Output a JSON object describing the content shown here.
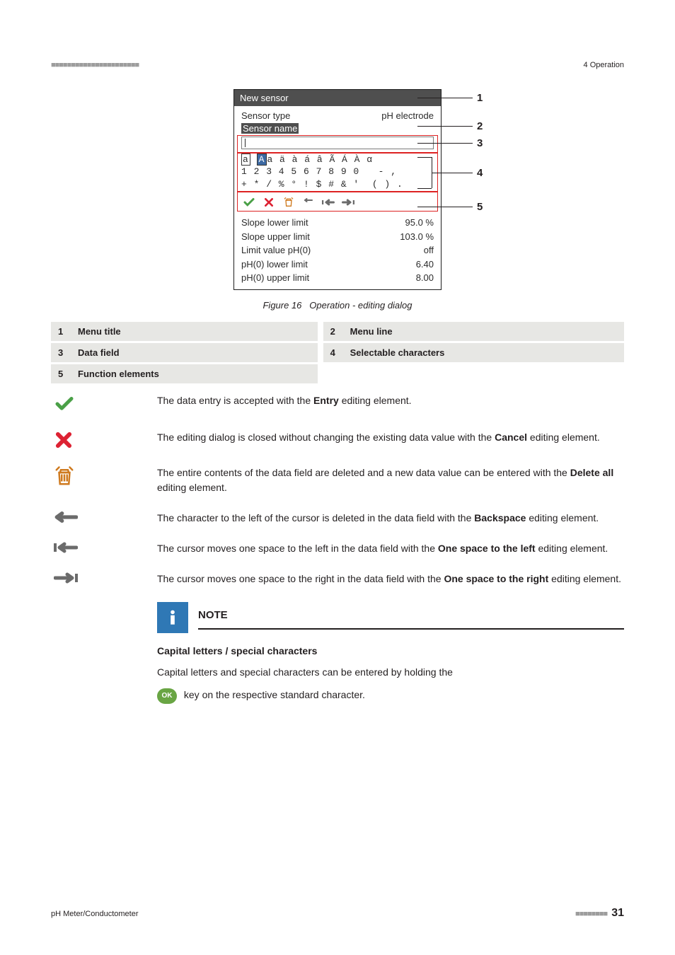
{
  "runhead": {
    "left_marks": "■■■■■■■■■■■■■■■■■■■■■■",
    "right": "4 Operation"
  },
  "device": {
    "title": "New sensor",
    "rows_top": [
      {
        "l": "Sensor type",
        "r": "pH electrode"
      }
    ],
    "hl_line": "Sensor name",
    "char_rows": {
      "r1a": "a",
      "r1_hl": "A",
      "r1_rest": "a ä à á â Ã Á À α",
      "r2": "1 2 3 4 5 6 7 8 9 0   - ,",
      "r3": "+ * / % ° ! $ # & '  ( ) ."
    },
    "rows_bottom": [
      {
        "l": "Slope lower limit",
        "r": "95.0 %"
      },
      {
        "l": "Slope upper limit",
        "r": "103.0 %"
      },
      {
        "l": "Limit value pH(0)",
        "r": "off"
      },
      {
        "l": "pH(0) lower limit",
        "r": "6.40"
      },
      {
        "l": "pH(0) upper limit",
        "r": "8.00"
      }
    ]
  },
  "callouts": [
    "1",
    "2",
    "3",
    "4",
    "5"
  ],
  "figure": {
    "num": "Figure 16",
    "title": "Operation - editing dialog"
  },
  "legend": [
    {
      "n": "1",
      "t": "Menu title"
    },
    {
      "n": "2",
      "t": "Menu line"
    },
    {
      "n": "3",
      "t": "Data field"
    },
    {
      "n": "4",
      "t": "Selectable characters"
    },
    {
      "n": "5",
      "t": "Function elements"
    }
  ],
  "descs": {
    "entry": {
      "pre": "The data entry is accepted with the ",
      "b": "Entry",
      "post": " editing element."
    },
    "cancel": {
      "pre": "The editing dialog is closed without changing the existing data value with the ",
      "b": "Cancel",
      "post": " editing element."
    },
    "delete": {
      "pre": "The entire contents of the data field are deleted and a new data value can be entered with the ",
      "b": "Delete all",
      "post": " editing element."
    },
    "backspace": {
      "pre": "The character to the left of the cursor is deleted in the data field with the ",
      "b": "Backspace",
      "post": " editing element."
    },
    "left": {
      "pre": "The cursor moves one space to the left in the data field with the ",
      "b": "One space to the left",
      "post": " editing element."
    },
    "right": {
      "pre": "The cursor moves one space to the right in the data field with the ",
      "b": "One space to the right",
      "post": " editing element."
    }
  },
  "note": {
    "title": "NOTE",
    "subtitle": "Capital letters / special characters",
    "line1": "Capital letters and special characters can be entered by holding the",
    "ok": "OK",
    "line2": " key on the respective standard character."
  },
  "footer": {
    "left": "pH Meter/Conductometer",
    "ticks": "■■■■■■■■",
    "page": "31"
  },
  "icons": {
    "check": "check-icon",
    "cross": "cross-icon",
    "trash": "trash-icon",
    "back": "backspace-icon",
    "barleft": "bar-left-icon",
    "barright": "bar-right-icon"
  }
}
